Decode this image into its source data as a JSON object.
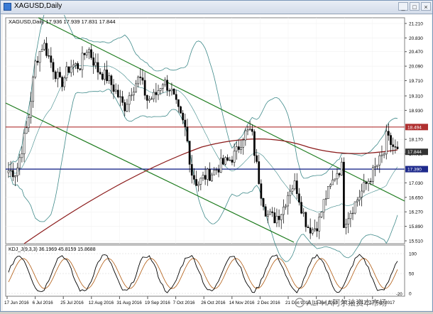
{
  "window": {
    "title": "XAGUSD,Daily"
  },
  "main_chart": {
    "label": "XAGUSD,Daily",
    "ohlc": "17.936 17.939 17.831 17.844",
    "price_axis": [
      "21.210",
      "20.830",
      "20.470",
      "20.090",
      "19.710",
      "19.310",
      "18.930",
      "18.170",
      "17.790",
      "17.030",
      "16.650",
      "16.270",
      "15.890",
      "15.510"
    ],
    "tags": [
      {
        "value": "18.494",
        "color": "#b03030"
      },
      {
        "value": "17.844",
        "color": "#333333"
      },
      {
        "value": "17.390",
        "color": "#1e2a8c"
      }
    ]
  },
  "indicator": {
    "label": "KDJ_J(9,3,3) 36.1969 45.8159 15.8688",
    "levels": [
      "100",
      "50",
      "0"
    ],
    "extra_tick": "-20"
  },
  "x_axis": [
    "17 Jun 2016",
    "6 Jul 2016",
    "25 Jul 2016",
    "12 Aug 2016",
    "31 Aug 2016",
    "19 Sep 2016",
    "7 Oct 2016",
    "26 Oct 2016",
    "14 Nov 2016",
    "2 Dec 2016",
    "21 Dec 2016",
    "11 Jan 2017",
    "30 Jan 2017",
    "17 Feb 2017"
  ],
  "watermark": "ALPHA阿尔法资本市场",
  "colors": {
    "channel": "#1c7a1c",
    "resistance": "#b03030",
    "support": "#1e2a8c",
    "ma": "#8b1a1a",
    "bands": "#3f8a8a",
    "candles": "#000000",
    "k_line": "#000000",
    "d_line": "#b05a10"
  }
}
